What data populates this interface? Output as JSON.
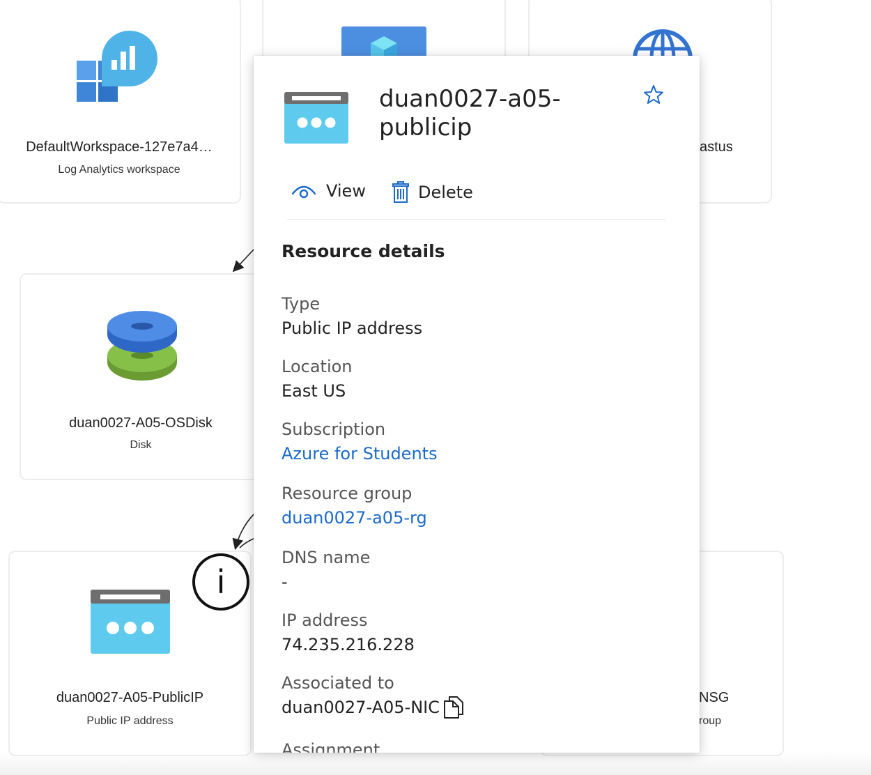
{
  "canvas": {
    "cards": {
      "workspace": {
        "title": "DefaultWorkspace-127e7a4…",
        "subtitle": "Log Analytics workspace"
      },
      "disk": {
        "title": "duan0027-A05-OSDisk",
        "subtitle": "Disk"
      },
      "publicip": {
        "title": "duan0027-A05-PublicIP",
        "subtitle": "Public IP address"
      },
      "location_partial": {
        "title": "astus"
      },
      "nsg_partial": {
        "title": "NSG",
        "subtitle": "roup"
      }
    },
    "info_button": {
      "glyph": "i"
    }
  },
  "panel": {
    "title": "duan0027-a05-publicip",
    "actions": {
      "view_label": "View",
      "delete_label": "Delete"
    },
    "section_heading": "Resource details",
    "fields": {
      "type": {
        "label": "Type",
        "value": "Public IP address"
      },
      "location": {
        "label": "Location",
        "value": "East US"
      },
      "subscription": {
        "label": "Subscription",
        "value": "Azure for Students"
      },
      "resource_group": {
        "label": "Resource group",
        "value": "duan0027-a05-rg"
      },
      "dns_name": {
        "label": "DNS name",
        "value": "-"
      },
      "ip_address": {
        "label": "IP address",
        "value": "74.235.216.228"
      },
      "associated_to": {
        "label": "Associated to",
        "value": "duan0027-A05-NIC"
      },
      "assignment": {
        "label": "Assignment"
      }
    }
  },
  "colors": {
    "link": "#1b6ac9",
    "azure_blue": "#3f86d8",
    "public_ip_cyan": "#5ecbee",
    "disk_green": "#7db544"
  },
  "icons": {
    "workspace": "log-analytics-icon",
    "vnet": "cube-icon",
    "region": "globe-icon",
    "disk": "disk-icon",
    "publicip": "public-ip-icon",
    "view": "eye-icon",
    "delete": "trash-icon",
    "favorite": "star-icon",
    "copy": "copy-icon",
    "info": "info-icon"
  }
}
